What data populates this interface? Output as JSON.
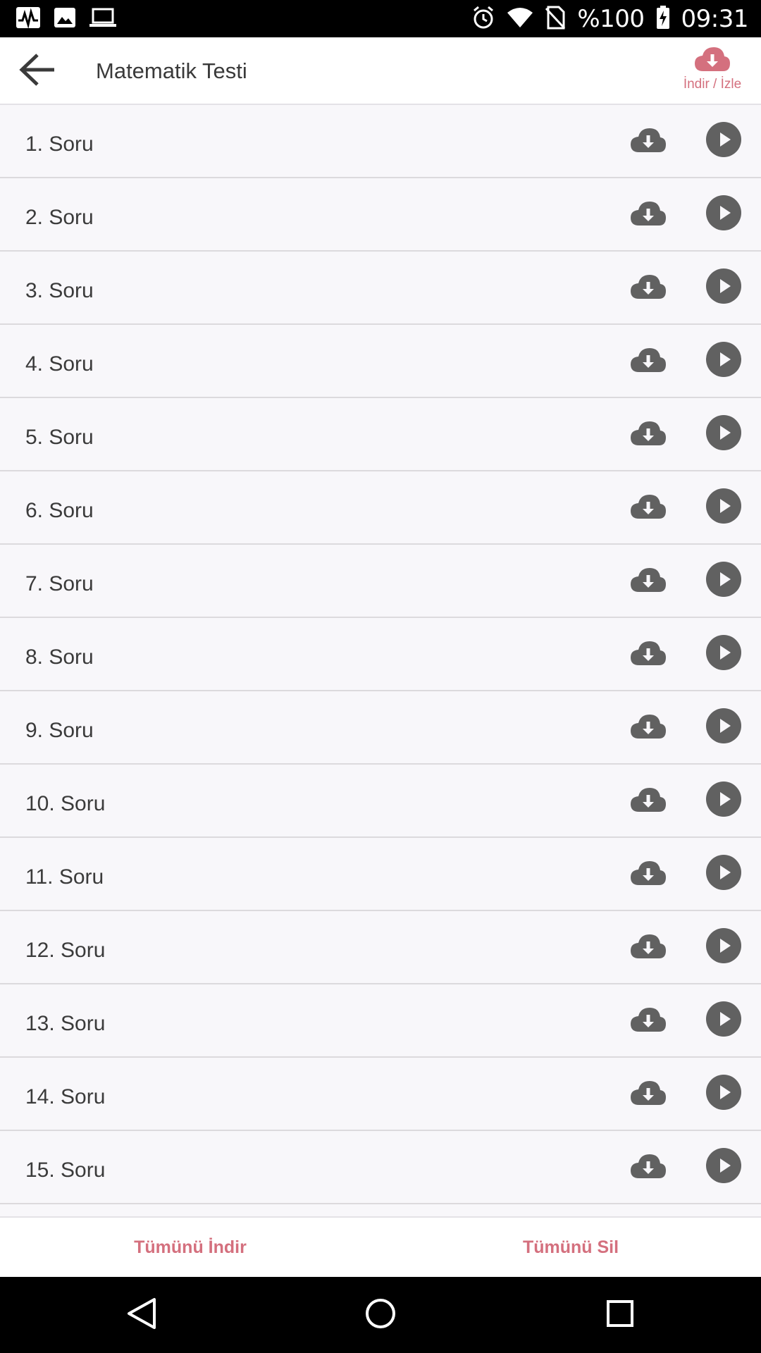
{
  "status_bar": {
    "battery": "%100",
    "time": "09:31",
    "left_icons": [
      "activity-icon",
      "image-icon",
      "laptop-icon"
    ],
    "right_icons": [
      "alarm-icon",
      "wifi-icon",
      "no-sim-icon",
      "battery-charging-icon"
    ]
  },
  "header": {
    "title": "Matematik Testi",
    "download_watch_label": "İndir / İzle"
  },
  "questions": [
    {
      "label": "1. Soru"
    },
    {
      "label": "2. Soru"
    },
    {
      "label": "3. Soru"
    },
    {
      "label": "4. Soru"
    },
    {
      "label": "5. Soru"
    },
    {
      "label": "6. Soru"
    },
    {
      "label": "7. Soru"
    },
    {
      "label": "8. Soru"
    },
    {
      "label": "9. Soru"
    },
    {
      "label": "10. Soru"
    },
    {
      "label": "11. Soru"
    },
    {
      "label": "12. Soru"
    },
    {
      "label": "13. Soru"
    },
    {
      "label": "14. Soru"
    },
    {
      "label": "15. Soru"
    }
  ],
  "bottom_actions": {
    "download_all": "Tümünü İndir",
    "delete_all": "Tümünü Sil"
  },
  "colors": {
    "accent": "#d4707e",
    "icon_gray": "#616161",
    "row_bg": "#f8f7fa"
  }
}
